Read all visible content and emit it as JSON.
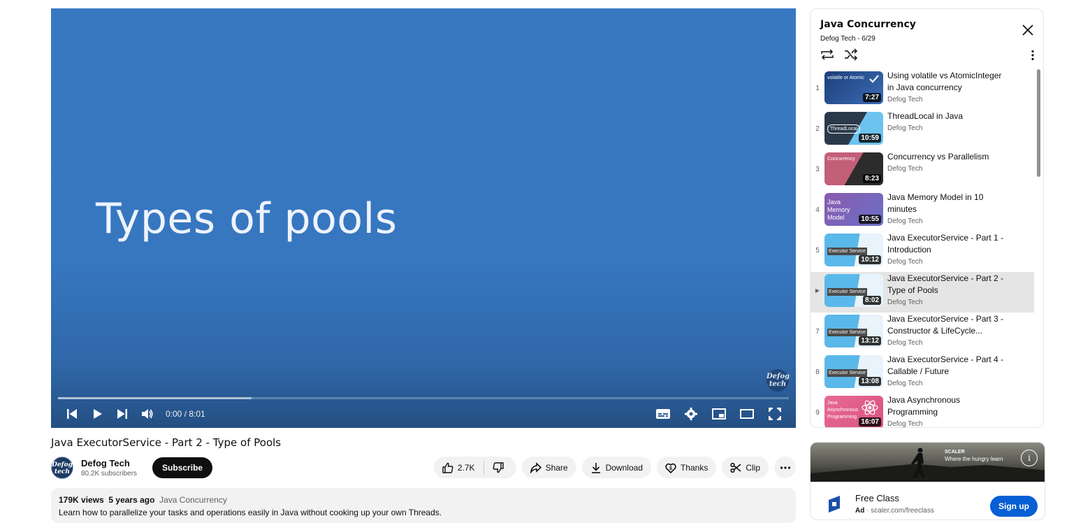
{
  "player": {
    "slide_title": "Types of pools",
    "watermark": "Defog tech",
    "time": "0:00 / 8:01",
    "progress_loaded": 0.265
  },
  "video": {
    "title": "Java ExecutorService - Part 2 - Type of Pools",
    "channel": "Defog Tech",
    "avatar_text": "Defog tech",
    "subscribers": "80.2K subscribers",
    "subscribe_label": "Subscribe",
    "likes": "2.7K",
    "share_label": "Share",
    "download_label": "Download",
    "thanks_label": "Thanks",
    "clip_label": "Clip"
  },
  "description": {
    "views": "179K views",
    "age": "5 years ago",
    "playlist": "Java Concurrency",
    "text": "Learn how to parallelize your tasks and operations easily in Java without cooking up your own Threads."
  },
  "playlist": {
    "title": "Java Concurrency",
    "subtitle": "Defog Tech - 6/29",
    "items": [
      {
        "idx": "1",
        "title": "Using volatile vs AtomicInteger in Java concurrency",
        "channel": "Defog Tech",
        "duration": "7:27",
        "thumb_text": "volatile or Atomic"
      },
      {
        "idx": "2",
        "title": "ThreadLocal in Java",
        "channel": "Defog Tech",
        "duration": "10:59",
        "thumb_text": "ThreadLocal"
      },
      {
        "idx": "3",
        "title": "Concurrency vs Parallelism",
        "channel": "Defog Tech",
        "duration": "8:23",
        "thumb_text": "Concurrency"
      },
      {
        "idx": "4",
        "title": "Java Memory Model in 10 minutes",
        "channel": "Defog Tech",
        "duration": "10:55",
        "thumb_text": "Java Memory Model"
      },
      {
        "idx": "5",
        "title": "Java ExecutorService - Part 1 - Introduction",
        "channel": "Defog Tech",
        "duration": "10:12",
        "thumb_text": "Executor Service"
      },
      {
        "idx": "▶",
        "title": "Java ExecutorService - Part 2 - Type of Pools",
        "channel": "Defog Tech",
        "duration": "8:02",
        "thumb_text": "Executor Service"
      },
      {
        "idx": "7",
        "title": "Java ExecutorService - Part 3 - Constructor & LifeCycle...",
        "channel": "Defog Tech",
        "duration": "13:12",
        "thumb_text": "Executor Service"
      },
      {
        "idx": "8",
        "title": "Java ExecutorService - Part 4 - Callable / Future",
        "channel": "Defog Tech",
        "duration": "13:08",
        "thumb_text": "Executor Service"
      },
      {
        "idx": "9",
        "title": "Java Asynchronous Programming",
        "channel": "Defog Tech",
        "duration": "16:07",
        "thumb_text": "Java Asynchronous Programming"
      }
    ]
  },
  "ad": {
    "brand": "SCALER",
    "tagline": "Where the hungry learn",
    "title": "Free Class",
    "ad_label": "Ad",
    "domain": "scaler.com/freeclass",
    "cta": "Sign up"
  },
  "colors": {
    "player_bg": "#3878c2",
    "subscribe_bg": "#0f0f0f",
    "cta_bg": "#065fd4",
    "active_item_bg": "#e5e5e5"
  }
}
